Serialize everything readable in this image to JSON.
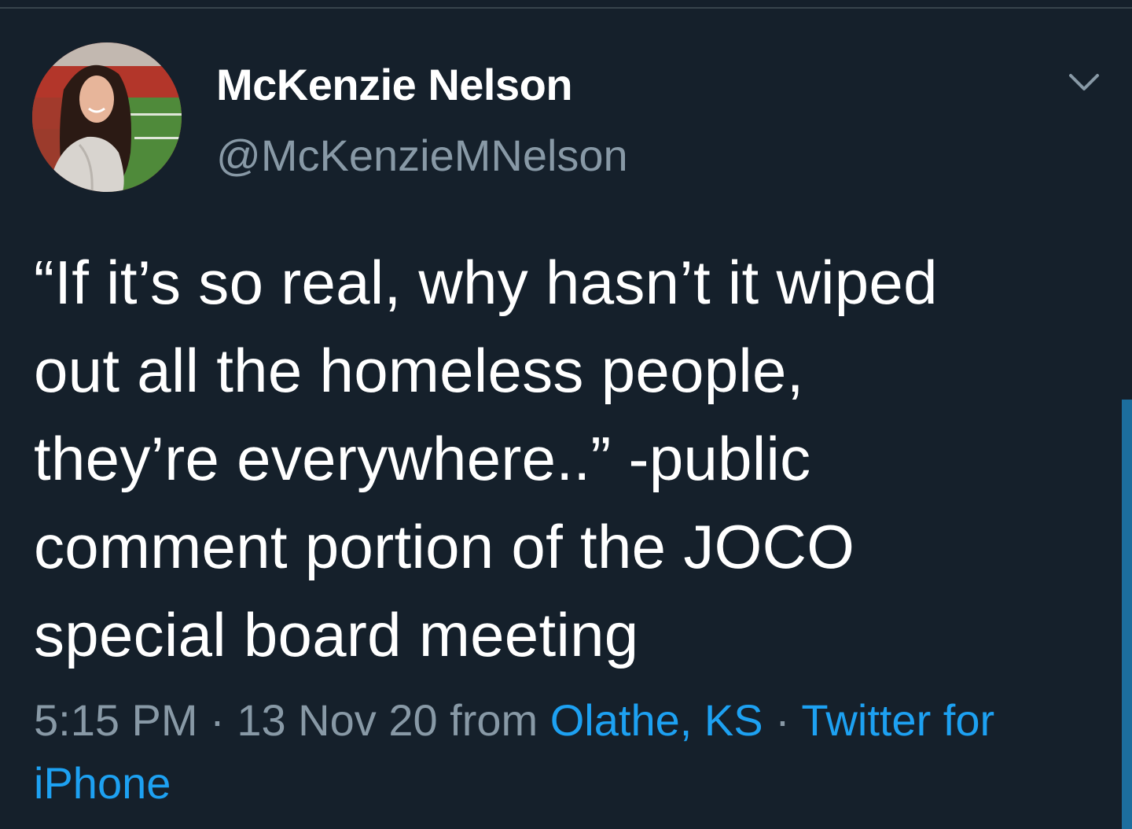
{
  "tweet": {
    "author": {
      "display_name": "McKenzie Nelson",
      "handle": "@McKenzieMNelson"
    },
    "text_lines": [
      "“If it’s so real, why hasn’t it wiped",
      "out all the homeless people,",
      "they’re everywhere..” -public",
      "comment portion of the JOCO",
      "special board meeting"
    ],
    "meta": {
      "time": "5:15 PM",
      "separator": " · ",
      "date": "13 Nov 20",
      "from_label": " from ",
      "location": "Olathe, KS",
      "source_part1": "Twitter for",
      "source_part2": "iPhone"
    }
  },
  "icons": {
    "menu": "chevron-down-icon"
  },
  "colors": {
    "background": "#15202b",
    "text_primary": "#ffffff",
    "text_secondary": "#8899a6",
    "link": "#1da1f2"
  }
}
